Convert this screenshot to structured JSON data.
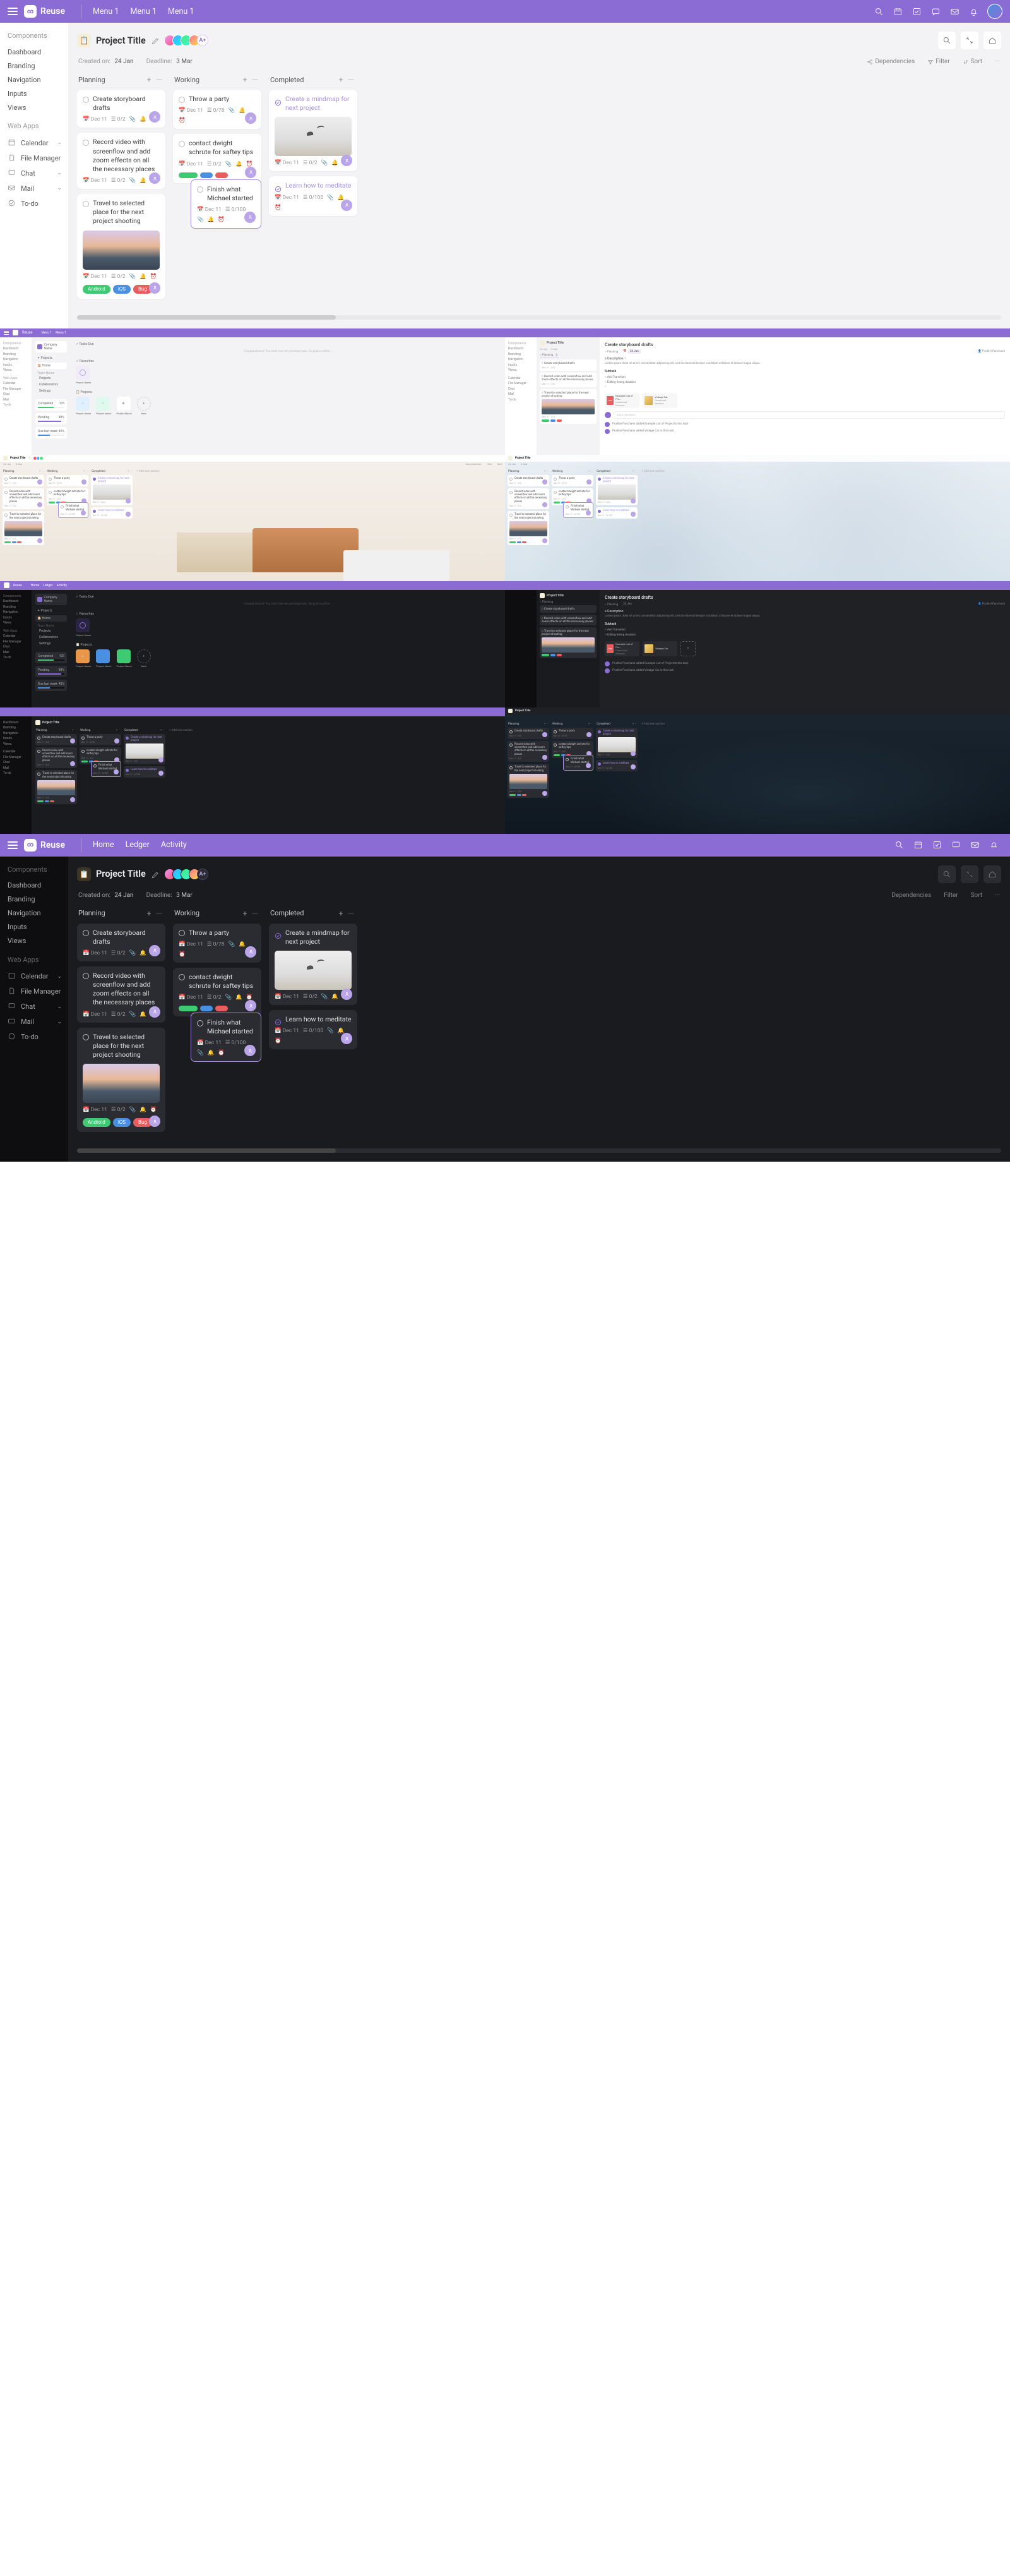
{
  "brand": "Reuse",
  "top_menu": [
    "Menu 1",
    "Menu 1",
    "Menu 1"
  ],
  "top_menu_dark": [
    "Home",
    "Ledger",
    "Activity"
  ],
  "sidebar": {
    "sections": [
      {
        "title": "Components",
        "items": [
          {
            "label": "Dashboard",
            "icon": null,
            "chev": false
          },
          {
            "label": "Branding",
            "icon": null,
            "chev": false
          },
          {
            "label": "Navigation",
            "icon": null,
            "chev": false
          },
          {
            "label": "Inputs",
            "icon": null,
            "chev": false
          },
          {
            "label": "Views",
            "icon": null,
            "chev": false
          }
        ]
      },
      {
        "title": "Web Apps",
        "items": [
          {
            "label": "Calendar",
            "icon": "calendar",
            "chev": true
          },
          {
            "label": "File Manager",
            "icon": "file",
            "chev": false
          },
          {
            "label": "Chat",
            "icon": "chat",
            "chev": true
          },
          {
            "label": "Mail",
            "icon": "mail",
            "chev": true
          },
          {
            "label": "To-do",
            "icon": "check",
            "chev": false
          }
        ]
      }
    ]
  },
  "project": {
    "title": "Project Title",
    "created_label": "Created on:",
    "created_val": "24 Jan",
    "deadline_label": "Deadline:",
    "deadline_val": "3 Mar",
    "dependencies_btn": "Dependencies",
    "filter_btn": "Filter",
    "sort_btn": "Sort",
    "avatar_extra": "A+"
  },
  "columns": [
    {
      "name": "Planning",
      "cards": [
        {
          "type": "basic",
          "title": "Create storyboard drafts",
          "date": "Dec 11",
          "progress": "0/2"
        },
        {
          "type": "basic",
          "title": "Record video with screenflow and add zoom effects on all the necessary places",
          "date": "Dec 11",
          "progress": "0/2"
        },
        {
          "type": "image",
          "title": "Travel to selected place for the next project shooting",
          "date": "Dec 11",
          "progress": "0/2",
          "img": "sunset",
          "pills": [
            "Android",
            "iOS",
            "Bug"
          ]
        }
      ]
    },
    {
      "name": "Working",
      "cards": [
        {
          "type": "basic",
          "title": "Throw a party",
          "date": "Dec 11",
          "progress": "0/78"
        },
        {
          "type": "pills",
          "title": "contact dwight schrute for saftey tips",
          "date": "Dec 11",
          "progress": "0/2"
        },
        {
          "type": "highlight",
          "title": "Finish what Michael started",
          "date": "Dec 11",
          "progress": "0/100"
        }
      ]
    },
    {
      "name": "Completed",
      "cards": [
        {
          "type": "done-img",
          "title": "Create a mindmap for next project",
          "date": "Dec 11",
          "progress": "0/2",
          "img": "seagull"
        },
        {
          "type": "done",
          "title": "Learn how to meditate",
          "date": "Dec 11",
          "progress": "0/100"
        }
      ]
    }
  ],
  "previews": {
    "row2_labels": {
      "company": "Company Name",
      "tasks_due": "Tasks Due",
      "projects": "Projects",
      "favourites": "Favourites",
      "home": "Home",
      "team": "Team Name",
      "collaborators": "Collaborators",
      "settings": "Settings",
      "completed": "Completed",
      "pending": "Pending",
      "due": "Due last week",
      "detail_title": "Create storyboard drafts",
      "author": "Prudhvi Panchami",
      "description": "Description",
      "subtask": "Subtask",
      "add_transition": "Add Transition",
      "editing_timing": "Editing timing duration",
      "activity1": "Prudhvi Panchami added Example List of Project to this task",
      "activity2": "Prudhvi Panchami added Vintage Car to this task",
      "add_section": "Add new section",
      "example_list": "Example List of Pro...",
      "download": "Download",
      "remove": "Remove",
      "vintage": "Vintage Car",
      "pdf": "PDF",
      "project_name": "Project Name",
      "new": "New"
    },
    "counts": {
      "completed": "103",
      "pending": "88%",
      "due": "45%"
    }
  }
}
